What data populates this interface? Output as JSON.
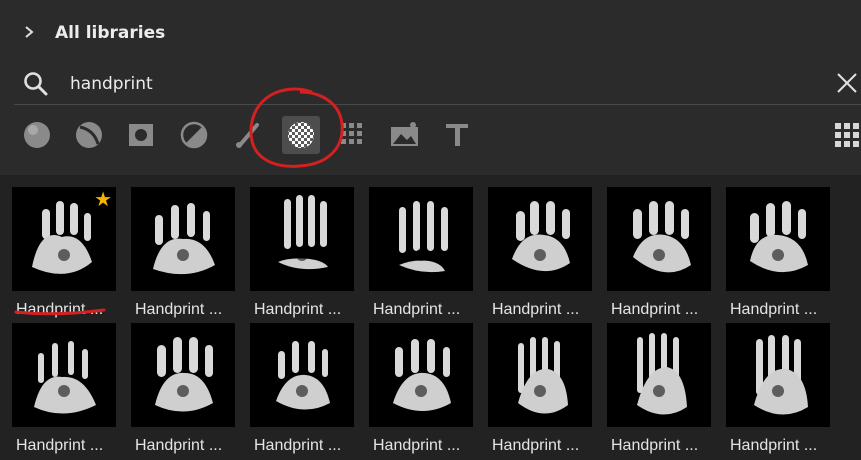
{
  "header": {
    "title": "All libraries"
  },
  "search": {
    "value": "handprint"
  },
  "toolbar": {
    "filters": [
      "color-icon",
      "gradient-icon",
      "layer-style-icon",
      "adjustment-icon",
      "brush-icon",
      "pattern-icon",
      "grid-icon",
      "image-icon",
      "text-icon"
    ],
    "active_filter": "pattern-icon",
    "view_toggle": "grid-view-icon"
  },
  "results": [
    {
      "label": "Handprint ...",
      "favorite": true
    },
    {
      "label": "Handprint ..."
    },
    {
      "label": "Handprint ..."
    },
    {
      "label": "Handprint ..."
    },
    {
      "label": "Handprint ..."
    },
    {
      "label": "Handprint ..."
    },
    {
      "label": "Handprint ..."
    },
    {
      "label": "Handprint ..."
    },
    {
      "label": "Handprint ..."
    },
    {
      "label": "Handprint ..."
    },
    {
      "label": "Handprint ..."
    },
    {
      "label": "Handprint ..."
    },
    {
      "label": "Handprint ..."
    },
    {
      "label": "Handprint ..."
    }
  ],
  "colors": {
    "annotation": "#d42020",
    "star": "#f5b400"
  }
}
